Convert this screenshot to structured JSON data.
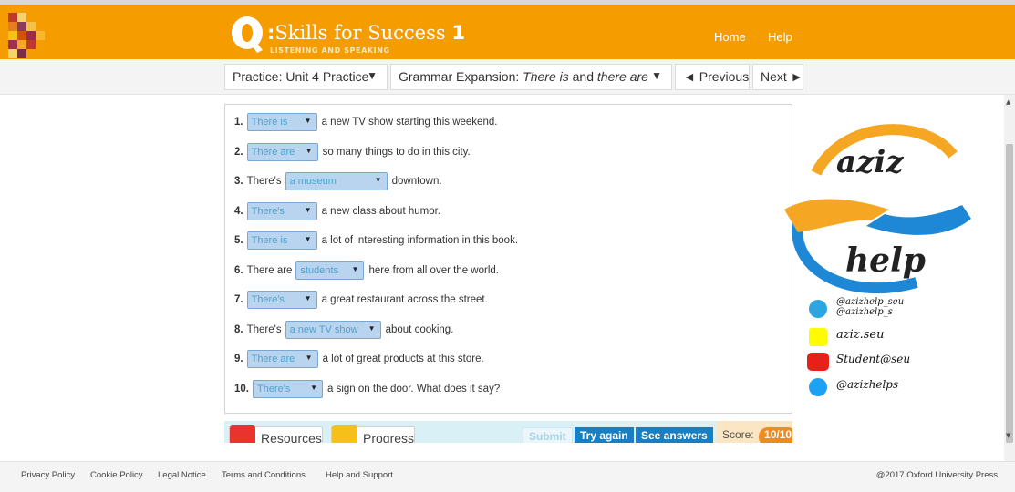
{
  "header": {
    "brand_name": "Skills for Success",
    "brand_level": "1",
    "brand_subtitle": "LISTENING AND SPEAKING",
    "brand_letter": "Q",
    "nav_home": "Home",
    "nav_help": "Help"
  },
  "subnav": {
    "practice_label": "Practice: Unit 4 Practice",
    "lesson_prefix": "Grammar Expansion: ",
    "lesson_em1": "There is",
    "lesson_and": " and ",
    "lesson_em2": "there are",
    "previous_label": "◄ Previous",
    "next_label": "Next ►"
  },
  "exercise": {
    "items": [
      {
        "num": "1.",
        "pre": "",
        "answer": "There is",
        "post": "a new TV show starting this weekend."
      },
      {
        "num": "2.",
        "pre": "",
        "answer": "There are",
        "post": "so many things to do in this city."
      },
      {
        "num": "3.",
        "pre": "There's",
        "answer": "a museum",
        "post": "downtown."
      },
      {
        "num": "4.",
        "pre": "",
        "answer": "There's",
        "post": "a new class about humor."
      },
      {
        "num": "5.",
        "pre": "",
        "answer": "There is",
        "post": "a lot of interesting information in this book."
      },
      {
        "num": "6.",
        "pre": "There are",
        "answer": "students",
        "post": "here from all over the world."
      },
      {
        "num": "7.",
        "pre": "",
        "answer": "There's",
        "post": "a great restaurant across the street."
      },
      {
        "num": "8.",
        "pre": "There's",
        "answer": "a new TV show",
        "post": "about cooking."
      },
      {
        "num": "9.",
        "pre": "",
        "answer": "There are",
        "post": "a lot of great products at this store."
      },
      {
        "num": "10.",
        "pre": "",
        "answer": "There's",
        "post": "a sign on the door. What does it say?"
      }
    ]
  },
  "toolbar": {
    "resources_label": "Resources",
    "progress_label": "Progress",
    "submit_label": "Submit",
    "try_again_label": "Try again",
    "see_answers_label": "See answers",
    "score_label": "Score:",
    "score_value": "10/10"
  },
  "watermark": {
    "top_word": "aziz",
    "bottom_word": "help",
    "telegram_1": "@azizhelp_seu",
    "telegram_2": "@azizhelp_s",
    "snapchat": "aziz.seu",
    "youtube": "Student@seu",
    "twitter": "@azizhelps"
  },
  "footer": {
    "links": [
      "Privacy Policy",
      "Cookie Policy",
      "Legal Notice",
      "Terms and Conditions",
      "Help and Support"
    ],
    "copyright": "@2017 Oxford University Press"
  },
  "colors": {
    "header_orange": "#f59c00",
    "select_blue": "#b8d4ef",
    "button_blue": "#1a7fc1",
    "score_orange": "#ee8a1e"
  }
}
